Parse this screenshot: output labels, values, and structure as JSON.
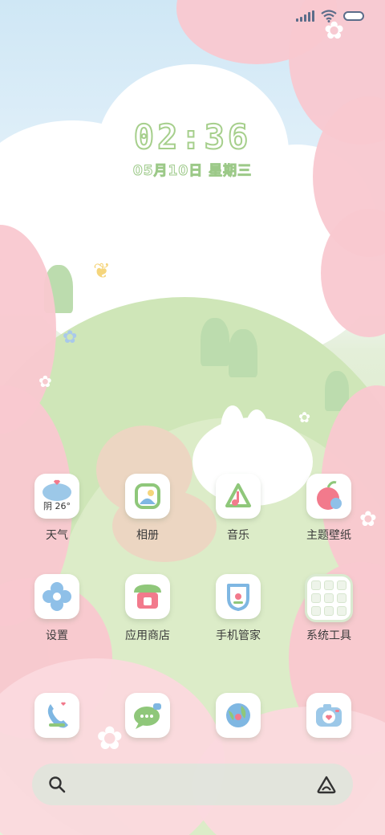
{
  "status_bar": {
    "icons": [
      "signal-icon",
      "wifi-icon",
      "battery-icon"
    ],
    "color": "#5b6d8a"
  },
  "clock": {
    "time": "02:36",
    "date": "05月10日 星期三"
  },
  "apps_row1": [
    {
      "label": "天气",
      "icon": "weather-icon",
      "weather_text": "阴 26°"
    },
    {
      "label": "相册",
      "icon": "gallery-icon"
    },
    {
      "label": "音乐",
      "icon": "music-icon"
    },
    {
      "label": "主题壁纸",
      "icon": "themes-icon"
    }
  ],
  "apps_row2": [
    {
      "label": "设置",
      "icon": "settings-icon"
    },
    {
      "label": "应用商店",
      "icon": "app-store-icon"
    },
    {
      "label": "手机管家",
      "icon": "phone-manager-icon"
    },
    {
      "label": "系统工具",
      "icon": "folder-icon"
    }
  ],
  "dock": [
    {
      "icon": "phone-icon"
    },
    {
      "icon": "messages-icon"
    },
    {
      "icon": "browser-icon"
    },
    {
      "icon": "camera-icon"
    }
  ],
  "search": {
    "left_icon": "search-icon",
    "right_icon": "assistant-icon"
  },
  "colors": {
    "accent_green": "#a6cf8c",
    "pink": "#f9c8d0",
    "sky": "#cfe7f5"
  }
}
